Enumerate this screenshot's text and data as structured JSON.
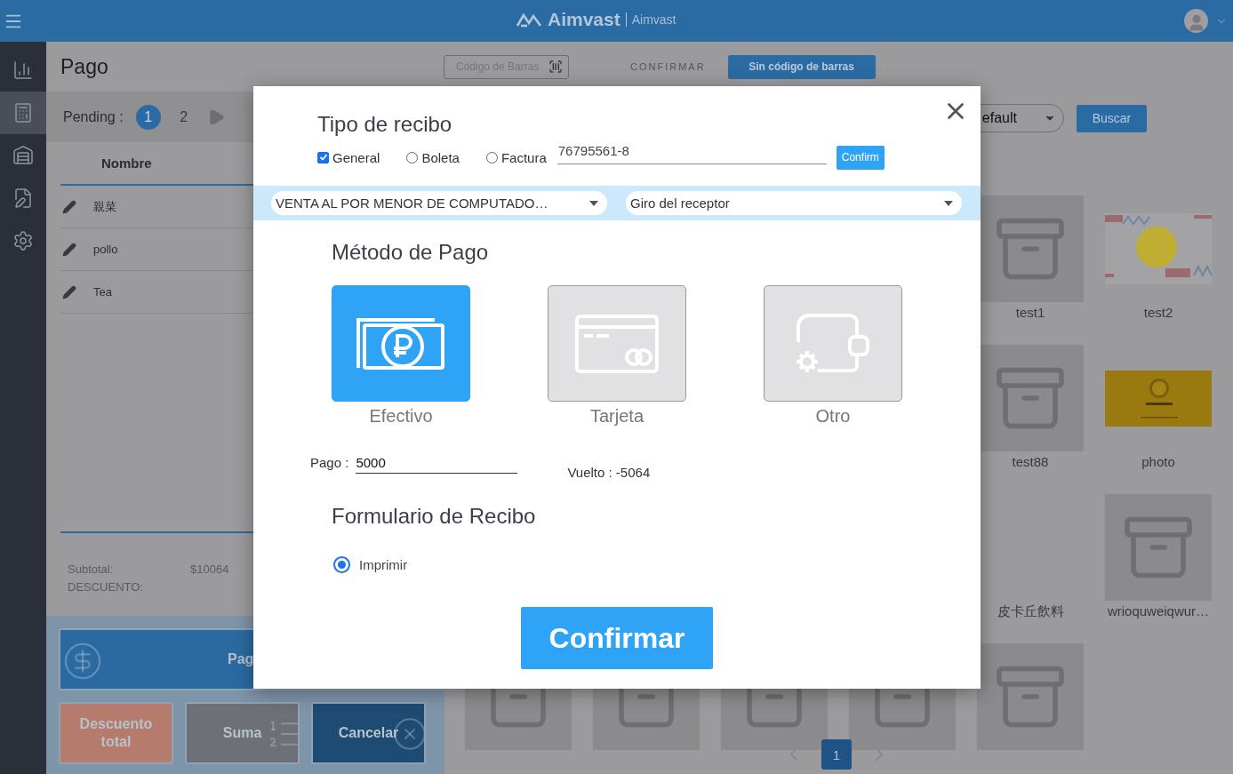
{
  "header": {
    "brand": "Aimvast",
    "subtitle": "Aimvast"
  },
  "sidebar": {
    "items": [
      {
        "selected": false
      },
      {
        "selected": true
      },
      {
        "selected": false
      },
      {
        "selected": false
      },
      {
        "selected": false
      }
    ]
  },
  "page": {
    "title": "Pago",
    "barcode": {
      "placeholder": "Código de Barras"
    },
    "confirm_label": "CONFIRMAR",
    "no_barcode_button": "Sin código de barras"
  },
  "pending": {
    "label": "Pending :",
    "tickets": [
      {
        "label": "1",
        "selected": true
      },
      {
        "label": "2",
        "selected": false
      }
    ]
  },
  "order_table": {
    "columns": [
      "Nombre"
    ],
    "rows": [
      {
        "name": "親菜"
      },
      {
        "name": "pollo"
      },
      {
        "name": "Tea"
      }
    ]
  },
  "totals": [
    {
      "label": "Subtotal:",
      "value": "$10064"
    },
    {
      "label": "DESCUENTO:"
    }
  ],
  "actions": [
    {
      "kind": "pay",
      "label": "Pag"
    },
    {
      "kind": "discount",
      "label": "Descuento total"
    },
    {
      "kind": "sum",
      "label": "Suma"
    },
    {
      "kind": "cancel",
      "label": "Cancelar"
    }
  ],
  "filter": {
    "value": "efault"
  },
  "search_button": "Buscar",
  "product_rows": [
    [
      {
        "name": "test1",
        "kind": "box"
      },
      {
        "name": "test2",
        "kind": "picture"
      }
    ],
    [
      {
        "name": "test88",
        "kind": "box"
      },
      {
        "name": "photo",
        "kind": "picture"
      }
    ],
    [
      {
        "name": "皮卡丘飲料",
        "kind": "empty"
      },
      {
        "name": "wrioquweiqwur…",
        "kind": "box"
      }
    ],
    [
      {
        "kind": "box"
      },
      {
        "kind": "box"
      },
      {
        "kind": "box"
      },
      {
        "kind": "box"
      },
      {
        "kind": "box"
      }
    ]
  ],
  "pagination": {
    "pages": [
      {
        "label": "1",
        "selected": true
      }
    ]
  },
  "receipt_dialog": {
    "title": "Tipo de recibo",
    "types": [
      {
        "kind": "checkbox",
        "label": "General",
        "selected": true
      },
      {
        "kind": "radio",
        "label": "Boleta",
        "selected": false
      },
      {
        "kind": "radio",
        "label": "Factura",
        "selected": false
      }
    ],
    "rut": {
      "value": "76795561-8"
    },
    "confirm_small": "Confirm",
    "selects": [
      {
        "value": "VENTA AL POR MENOR DE COMPUTADO…"
      },
      {
        "value": "Giro del receptor"
      }
    ],
    "payment_title": "Método de Pago",
    "methods": [
      {
        "kind": "cash",
        "label": "Efectivo",
        "selected": true
      },
      {
        "kind": "card",
        "label": "Tarjeta",
        "selected": false
      },
      {
        "kind": "other",
        "label": "Otro",
        "selected": false
      }
    ],
    "payment": {
      "label": "Pago :",
      "value": "5000"
    },
    "change": {
      "label": "Vuelto :",
      "value": "-5064"
    },
    "form_title": "Formulario de Recibo",
    "form_options": [
      {
        "label": "Imprimir",
        "selected": true
      }
    ],
    "confirm_button": "Confirmar"
  }
}
